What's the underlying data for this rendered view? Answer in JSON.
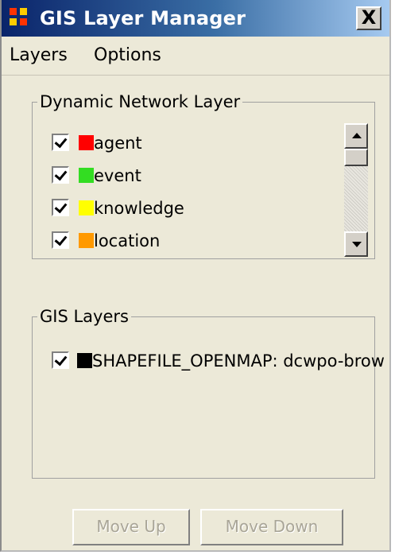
{
  "window": {
    "title": "GIS Layer Manager",
    "close_label": "X"
  },
  "menu": {
    "items": [
      "Layers",
      "Options"
    ]
  },
  "dynamic_network": {
    "legend": "Dynamic Network Layer",
    "layers": [
      {
        "label": "agent",
        "color": "#ff0000",
        "checked": true
      },
      {
        "label": "event",
        "color": "#33dd22",
        "checked": true
      },
      {
        "label": "knowledge",
        "color": "#ffff00",
        "checked": true
      },
      {
        "label": "location",
        "color": "#ff9900",
        "checked": true
      }
    ]
  },
  "gis_layers": {
    "legend": "GIS Layers",
    "layers": [
      {
        "label": "SHAPEFILE_OPENMAP: dcwpo-brow",
        "color": "#000000",
        "checked": true
      }
    ]
  },
  "buttons": {
    "move_up": "Move Up",
    "move_down": "Move Down"
  }
}
